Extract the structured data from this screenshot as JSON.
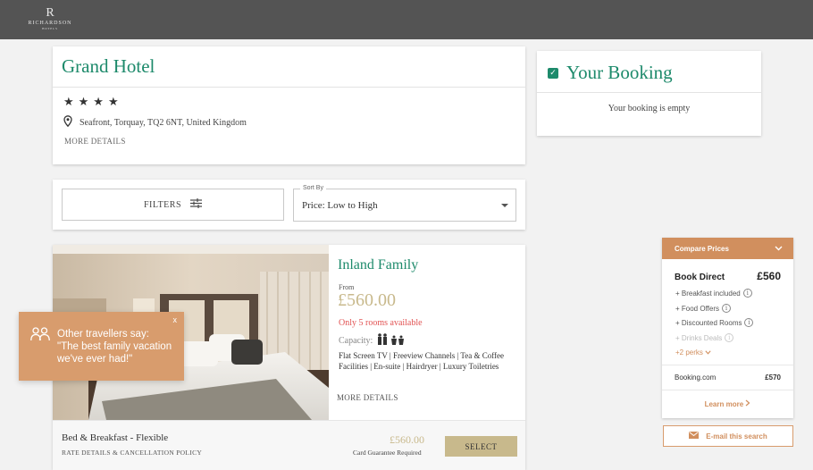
{
  "brand": {
    "logo_letter": "R",
    "logo_word": "RICHARDSON",
    "logo_sub": "HOTELS"
  },
  "hotel": {
    "name": "Grand Hotel",
    "stars": "★★★★",
    "address": "Seafront, Torquay, TQ2 6NT, United Kingdom",
    "more_details": "MORE DETAILS"
  },
  "booking": {
    "title": "Your Booking",
    "empty_text": "Your booking is empty"
  },
  "filters": {
    "label": "FILTERS",
    "sort_label": "Sort By",
    "sort_value": "Price: Low to High"
  },
  "room": {
    "title": "Inland Family",
    "from_label": "From",
    "price": "£560.00",
    "availability": "Only 5 rooms available",
    "capacity_label": "Capacity:",
    "amenities": "Flat Screen TV | Freeview Channels | Tea & Coffee Facilities | En-suite | Hairdryer | Luxury Toiletries",
    "more_details": "MORE DETAILS",
    "rate": {
      "name": "Bed & Breakfast - Flexible",
      "policy": "RATE DETAILS & CANCELLATION POLICY",
      "price": "£560.00",
      "guarantee": "Card Guarantee Required",
      "select_label": "SELECT"
    }
  },
  "travellers_popup": {
    "close": "x",
    "text_line1": "Other travellers say:",
    "text_line2": "\"The best family vacation",
    "text_line3": "we've ever had!\""
  },
  "compare": {
    "title": "Compare Prices",
    "direct_label": "Book Direct",
    "direct_price": "£560",
    "perks": [
      "+ Breakfast included",
      "+ Food Offers",
      "+ Discounted Rooms",
      "+ Drinks Deals"
    ],
    "more_perks": "+2 perks",
    "other_name": "Booking.com",
    "other_price": "£570",
    "learn_more": "Learn more",
    "email_label": "E-mail this search"
  },
  "colors": {
    "brand_green": "#1d8a6b",
    "gold": "#c8b98c",
    "orange": "#d18f5e",
    "alert_red": "#e25454"
  }
}
